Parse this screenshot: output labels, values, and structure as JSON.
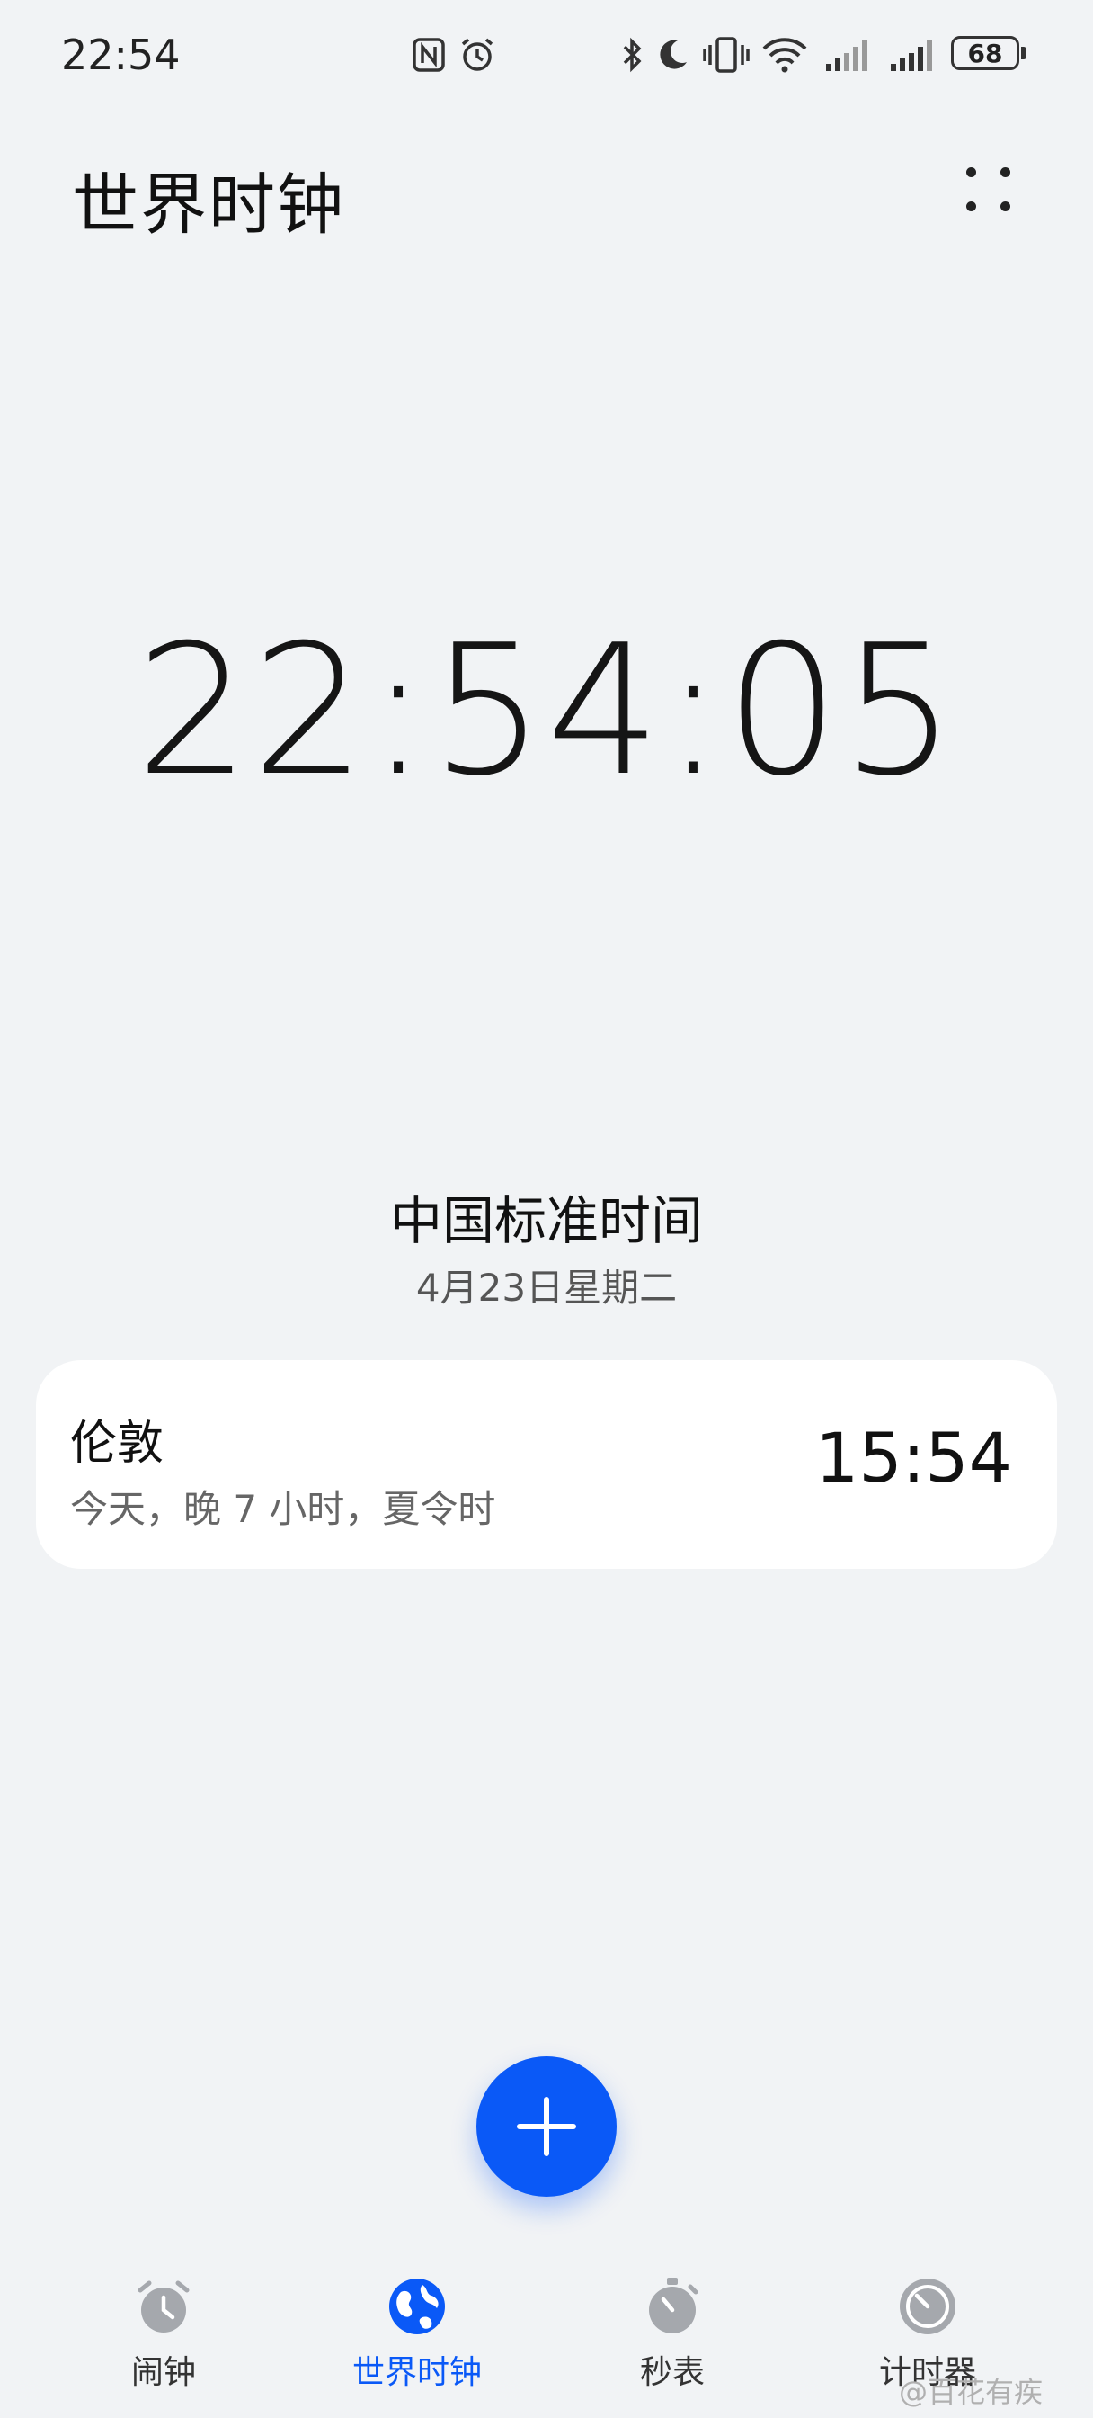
{
  "status_bar": {
    "time": "22:54",
    "battery": "68",
    "icons": [
      "nfc-icon",
      "alarm-icon",
      "bluetooth-icon",
      "moon-icon",
      "vibrate-icon",
      "wifi-icon",
      "signal-icon",
      "signal-icon"
    ]
  },
  "header": {
    "title": "世界时钟",
    "more_icon": "more-dots-icon"
  },
  "clock": {
    "time": "22:54:05",
    "timezone": "中国标准时间",
    "date": "4月23日星期二"
  },
  "cities": [
    {
      "name": "伦敦",
      "description": "今天，晚 7 小时，夏令时",
      "time": "15:54"
    }
  ],
  "fab": {
    "icon": "plus-icon"
  },
  "nav": [
    {
      "label": "闹钟",
      "icon": "alarm-clock-icon",
      "active": false
    },
    {
      "label": "世界时钟",
      "icon": "globe-icon",
      "active": true
    },
    {
      "label": "秒表",
      "icon": "stopwatch-icon",
      "active": false
    },
    {
      "label": "计时器",
      "icon": "timer-icon",
      "active": false
    }
  ],
  "colors": {
    "accent": "#0a59f7",
    "background": "#f1f3f5",
    "card": "#ffffff",
    "inactive_icon": "#a5a8ad"
  },
  "watermark": "@百花有疾"
}
